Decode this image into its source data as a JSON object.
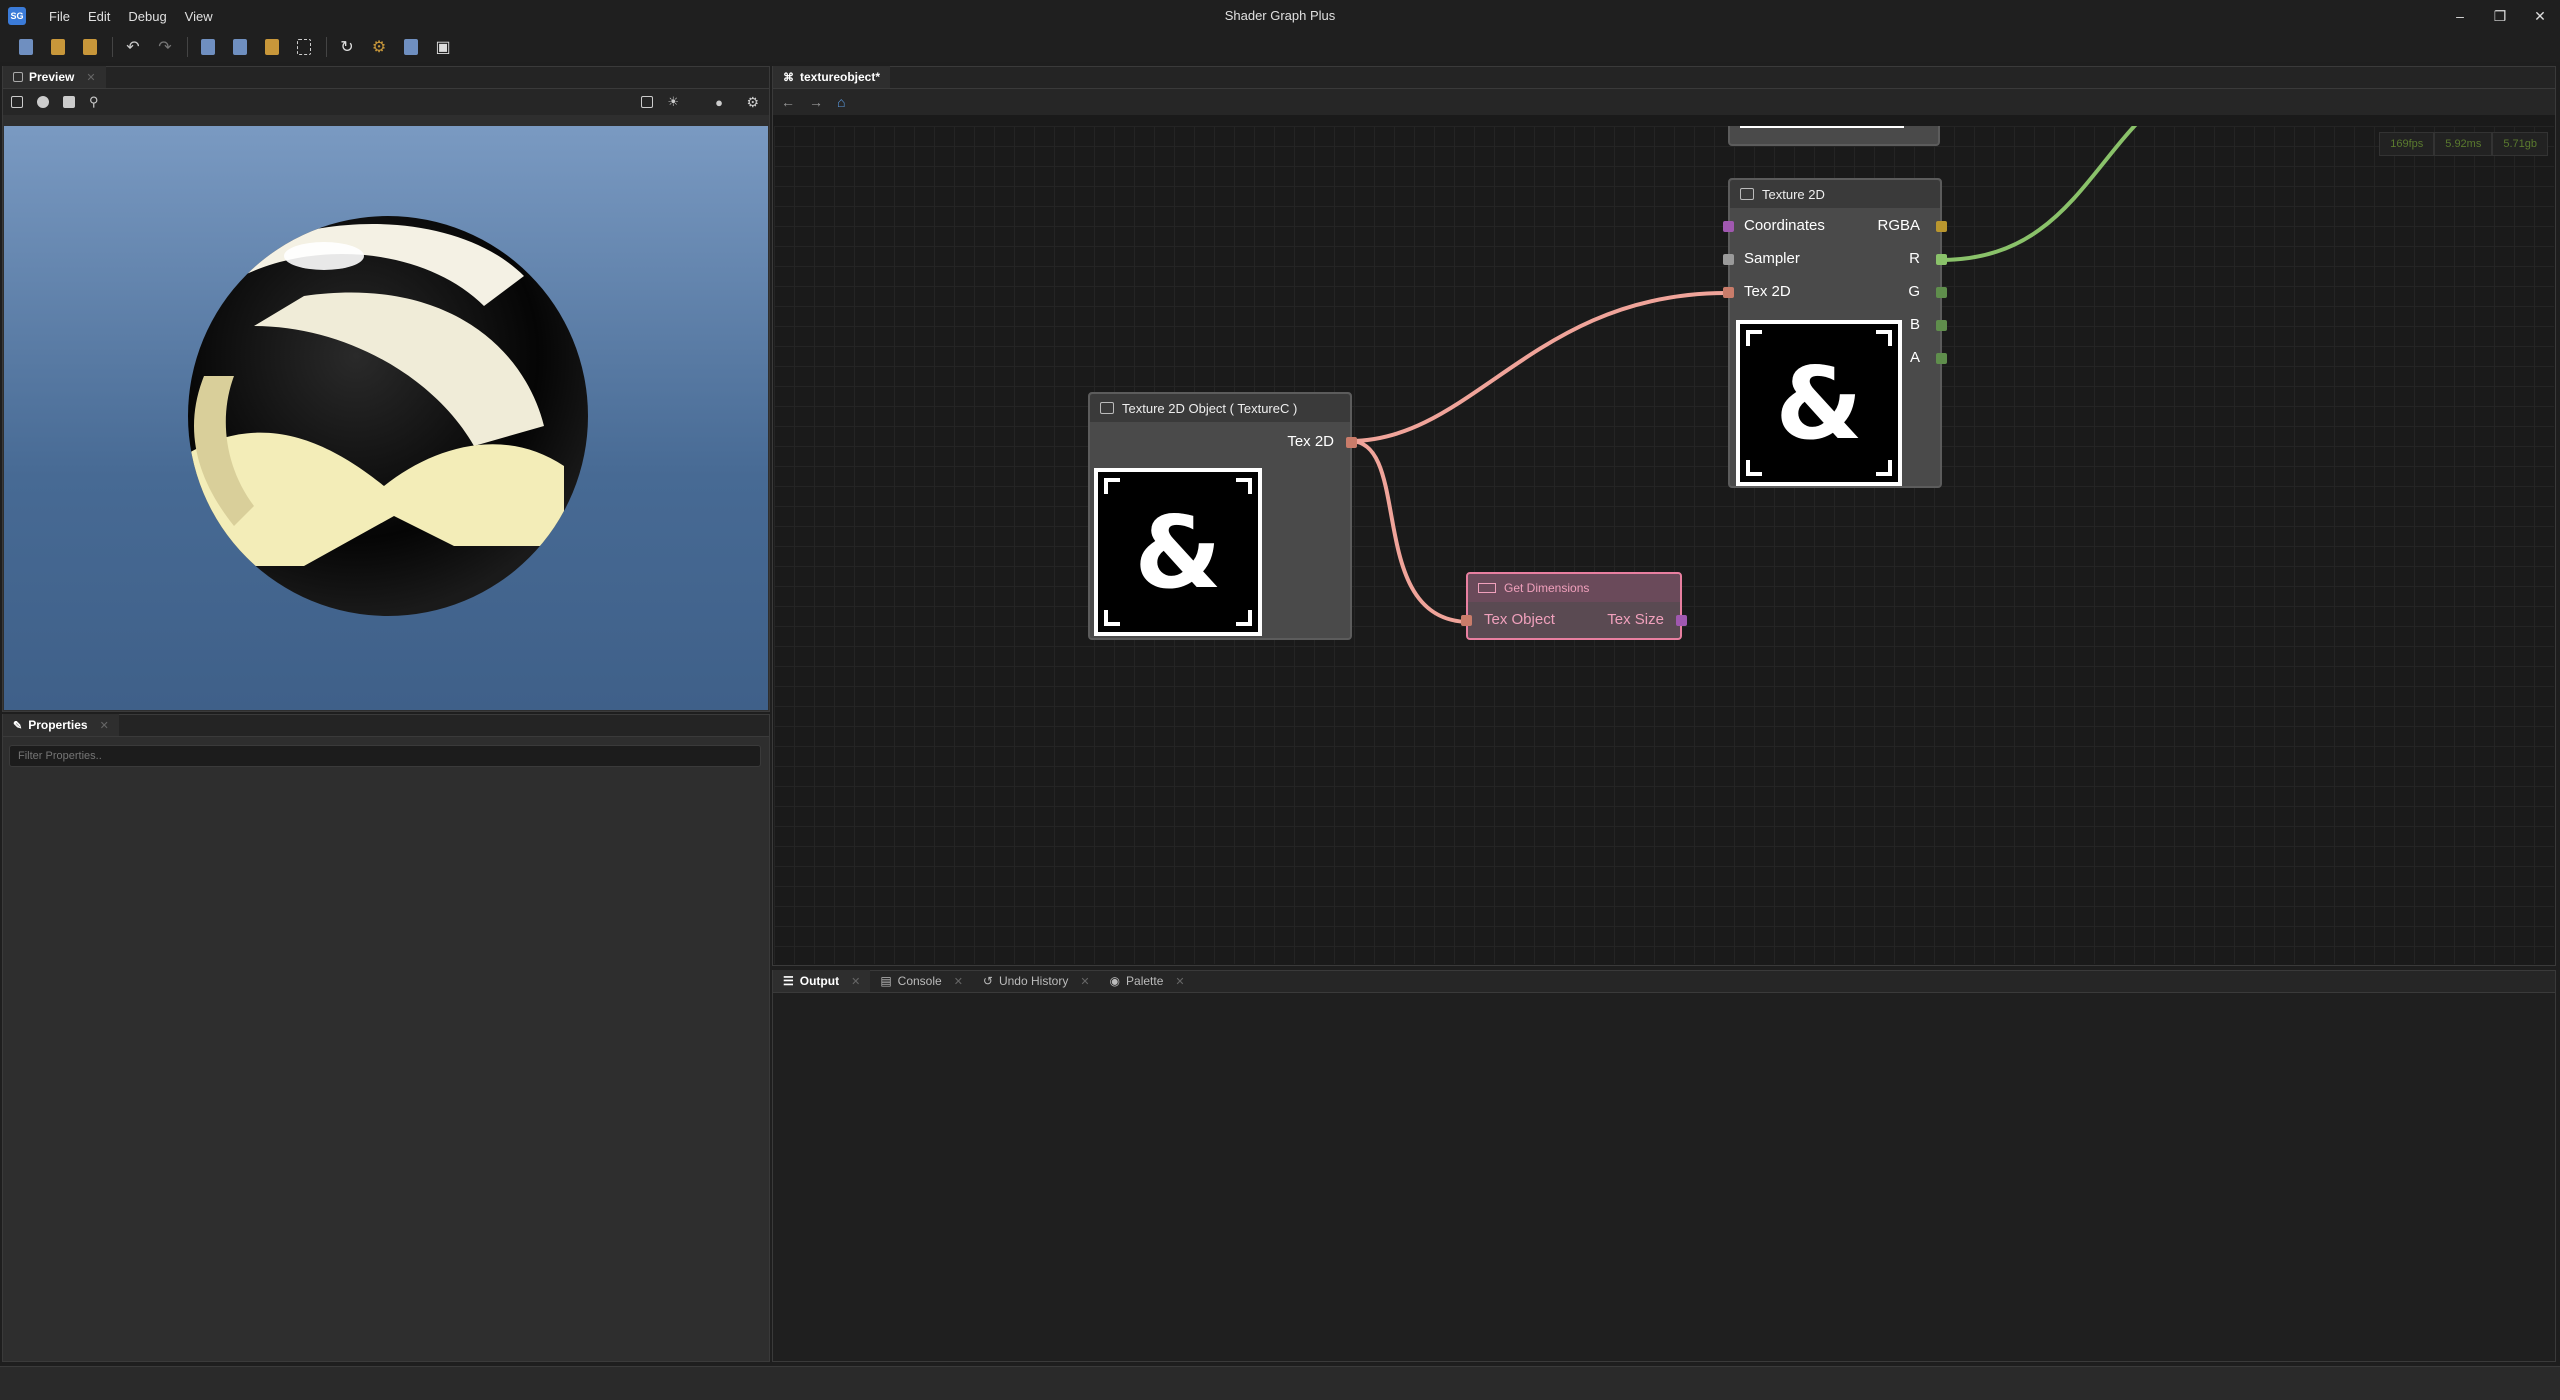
{
  "app": {
    "title": "Shader Graph Plus",
    "logo_text": "SG"
  },
  "menu": [
    "File",
    "Edit",
    "Debug",
    "View"
  ],
  "preview": {
    "tab": "Preview"
  },
  "properties": {
    "tab": "Properties",
    "filter_placeholder": "Filter Properties.."
  },
  "graph": {
    "tab": "textureobject*",
    "stats": {
      "fps": "169fps",
      "ms": "5.92ms",
      "mem": "5.71gb"
    },
    "texture2d_node": {
      "title": "Texture 2D",
      "inputs": [
        "Coordinates",
        "Sampler",
        "Tex 2D"
      ],
      "outputs": [
        "RGBA",
        "R",
        "G",
        "B",
        "A"
      ]
    },
    "texobj_node": {
      "title": "Texture 2D Object ( TextureC )",
      "output": "Tex 2D"
    },
    "getdim_node": {
      "title": "Get Dimensions",
      "input": "Tex Object",
      "output": "Tex Size"
    },
    "thumb_glyph": "&"
  },
  "bottom": {
    "tabs": [
      "Output",
      "Console",
      "Undo History",
      "Palette"
    ]
  },
  "colors": {
    "wire_tex": "#f0a49a",
    "wire_green": "#8ac26a",
    "pin_purple": "#a058b0",
    "pin_gray": "#9a9a9a",
    "pin_orange": "#c97c6a",
    "pin_gold": "#b9962e",
    "pin_green": "#5f8e4c",
    "getdim_border": "#e87fa0"
  }
}
